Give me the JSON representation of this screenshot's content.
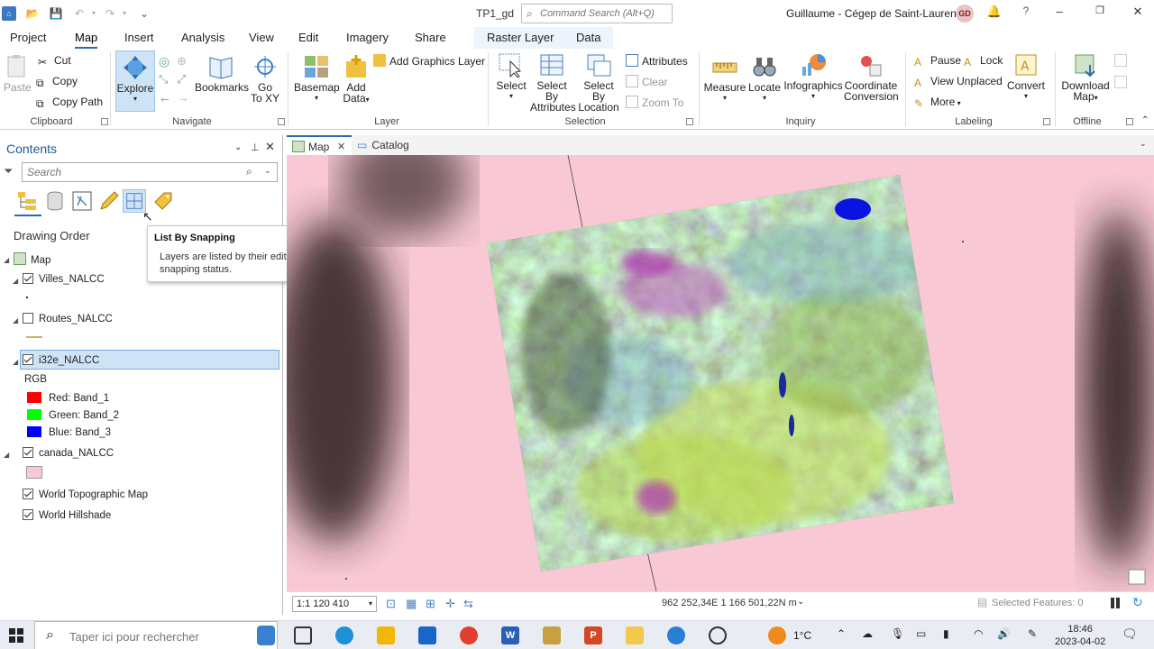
{
  "titlebar": {
    "doc_title": "TP1_gd",
    "command_search_placeholder": "Command Search (Alt+Q)",
    "user": "Guillaume - Cégep de Saint-Laurent",
    "avatar_initials": "GD"
  },
  "tabs": [
    "Project",
    "Map",
    "Insert",
    "Analysis",
    "View",
    "Edit",
    "Imagery",
    "Share"
  ],
  "active_tab": "Map",
  "context_tabs": [
    "Raster Layer",
    "Data"
  ],
  "ribbon": {
    "clipboard": {
      "label": "Clipboard",
      "paste": "Paste",
      "cut": "Cut",
      "copy": "Copy",
      "copy_path": "Copy Path"
    },
    "navigate": {
      "label": "Navigate",
      "explore": "Explore",
      "bookmarks": "Bookmarks",
      "go": "Go",
      "to_xy": "To XY"
    },
    "layer": {
      "label": "Layer",
      "basemap": "Basemap",
      "add": "Add",
      "data": "Data",
      "add_graphics": "Add Graphics Layer"
    },
    "selection": {
      "label": "Selection",
      "select": "Select",
      "select_by": "Select By",
      "attributes": "Attributes",
      "location": "Location",
      "attributes_btn": "Attributes",
      "clear": "Clear",
      "zoom_to": "Zoom To"
    },
    "inquiry": {
      "label": "Inquiry",
      "measure": "Measure",
      "locate": "Locate",
      "infographics": "Infographics",
      "coordinate": "Coordinate",
      "conversion": "Conversion"
    },
    "labeling": {
      "label": "Labeling",
      "pause": "Pause",
      "lock": "Lock",
      "view_unplaced": "View Unplaced",
      "more": "More",
      "convert": "Convert"
    },
    "offline": {
      "label": "Offline",
      "download": "Download",
      "map": "Map"
    }
  },
  "contents": {
    "title": "Contents",
    "search_placeholder": "Search",
    "drawing_order": "Drawing Order",
    "map_name": "Map",
    "layers": {
      "villes": "Villes_NALCC",
      "routes": "Routes_NALCC",
      "i32e": "i32e_NALCC",
      "rgb": "RGB",
      "red": "Red:  Band_1",
      "green": "Green: Band_2",
      "blue": "Blue:  Band_3",
      "canada": "canada_NALCC",
      "topo": "World Topographic Map",
      "hillshade": "World Hillshade"
    },
    "checked": {
      "villes": true,
      "routes": false,
      "i32e": true,
      "canada": true,
      "topo": true,
      "hillshade": true
    }
  },
  "tooltip": {
    "title": "List By Snapping",
    "body": "Layers are listed by their edit snapping status."
  },
  "view_tabs": [
    "Map",
    "Catalog"
  ],
  "status": {
    "scale": "1:1 120 410",
    "coordinates": "962 252,34E 1 166 501,22N m",
    "selected_features": "Selected Features: 0"
  },
  "taskbar": {
    "search_placeholder": "Taper ici pour rechercher",
    "weather": "1°C",
    "time": "18:46",
    "date": "2023-04-02"
  },
  "colors": {
    "accent": "#2b6cb0",
    "map_background": "#f8c8d4",
    "red_band": "#ff0000",
    "green_band": "#00ff00",
    "blue_band": "#0000ff"
  }
}
